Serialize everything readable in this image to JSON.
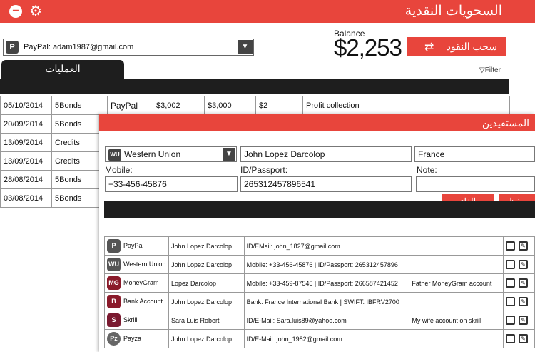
{
  "header": {
    "title": "السحويات النقدية",
    "accent": "#e8453c"
  },
  "account_select": {
    "value": "PayPal: adam1987@gmail.com"
  },
  "balance": {
    "label": "Balance",
    "amount": "$2,253"
  },
  "withdraw_label": "سحب النقود",
  "tab_label": "العمليات",
  "filter_label": "Filter",
  "transactions": [
    {
      "date": "05/10/2014",
      "type": "5Bonds",
      "method": "PayPal",
      "amount": "$3,002",
      "amount2": "$3,000",
      "fee": "$2",
      "note": "Profit collection"
    },
    {
      "date": "20/09/2014",
      "type": "5Bonds"
    },
    {
      "date": "13/09/2014",
      "type": "Credits"
    },
    {
      "date": "13/09/2014",
      "type": "Credits"
    },
    {
      "date": "28/08/2014",
      "type": "5Bonds"
    },
    {
      "date": "03/08/2014",
      "type": "5Bonds"
    }
  ],
  "beneficiaries_panel": {
    "title": "المستفيدين",
    "method": "Western Union",
    "method_icon": "WU",
    "name": "John Lopez Darcolop",
    "country": "France",
    "mobile_label": "Mobile:",
    "mobile": "+33-456-45876",
    "id_label": "ID/Passport:",
    "id_value": "265312457896541",
    "note_label": "Note:",
    "note": "",
    "save_label": "حفظ",
    "cancel_label": "الغاء",
    "rows": [
      {
        "icon": "P",
        "method": "PayPal",
        "name": "John Lopez Darcolop",
        "details": "ID/EMail: john_1827@gmail.com",
        "note": ""
      },
      {
        "icon": "WU",
        "method": "Western Union",
        "name": "John Lopez Darcolop",
        "details": "Mobile: +33-456-45876 | ID/Passport: 265312457896",
        "note": ""
      },
      {
        "icon": "MG",
        "method": "MoneyGram",
        "name": "Lopez Darcolop",
        "details": "Mobile: +33-459-87546 | ID/Passport: 266587421452",
        "note": "Father MoneyGram account"
      },
      {
        "icon": "B",
        "method": "Bank Account",
        "name": "John Lopez Darcolop",
        "details": "Bank: France International Bank | SWIFT: IBFRV2700",
        "note": ""
      },
      {
        "icon": "S",
        "method": "Skrill",
        "name": "Sara Luis Robert",
        "details": "ID/E-Mail: Sara.luis89@yahoo.com",
        "note": "My wife account on skrill"
      },
      {
        "icon": "Pz",
        "method": "Payza",
        "name": "John Lopez Darcolop",
        "details": "ID/E-Mail: john_1982@gmail.com",
        "note": ""
      }
    ]
  }
}
